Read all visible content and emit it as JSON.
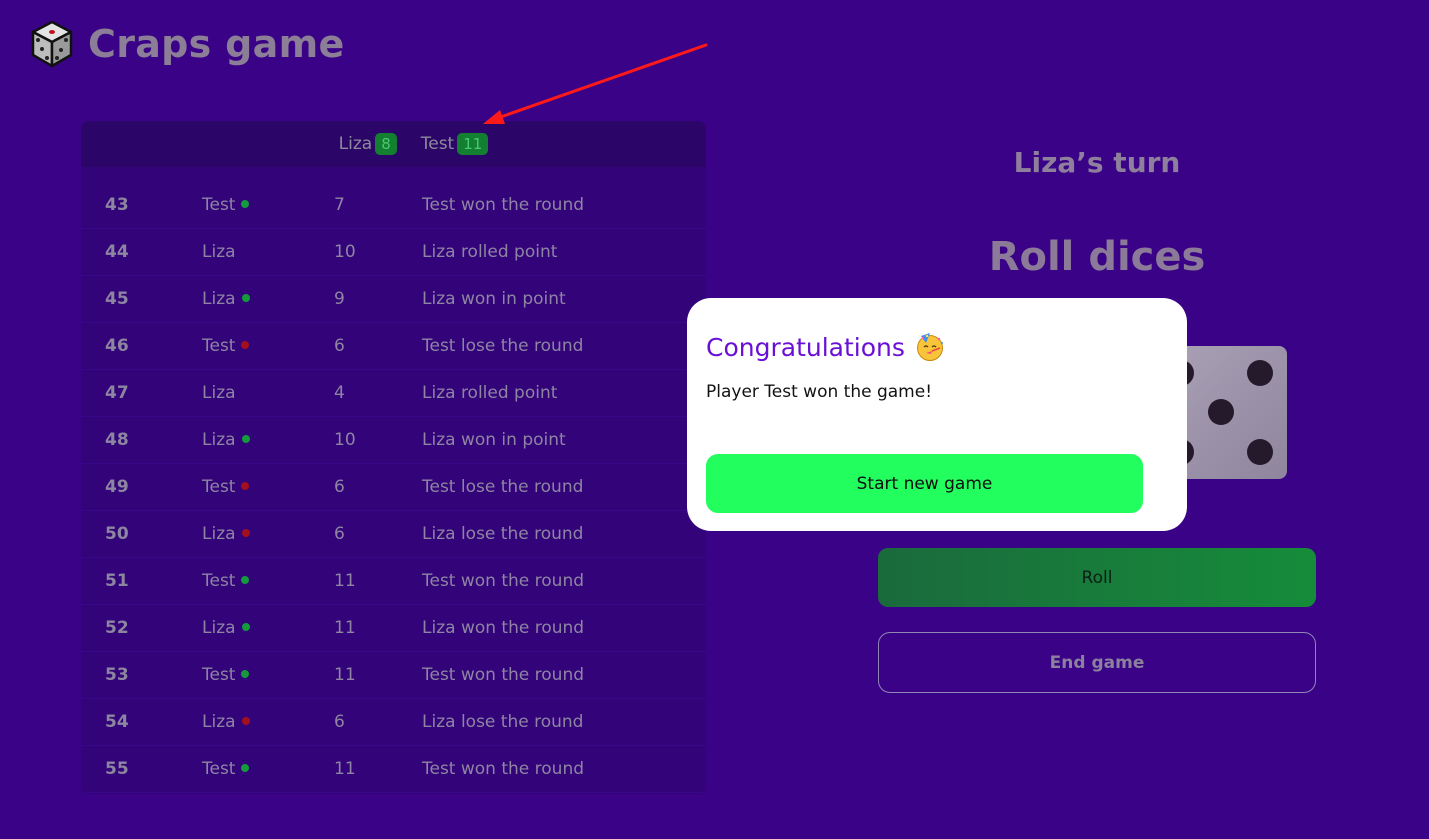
{
  "app": {
    "title": "Craps game",
    "logo_icon": "dice-icon"
  },
  "scoreboard": {
    "players": [
      {
        "name": "Liza",
        "score": "8"
      },
      {
        "name": "Test",
        "score": "11"
      }
    ]
  },
  "history": [
    {
      "num": "43",
      "player": "Test",
      "status": "win",
      "roll": "7",
      "result": "Test won the round"
    },
    {
      "num": "44",
      "player": "Liza",
      "status": "none",
      "roll": "10",
      "result": "Liza rolled point"
    },
    {
      "num": "45",
      "player": "Liza",
      "status": "win",
      "roll": "9",
      "result": "Liza won in point"
    },
    {
      "num": "46",
      "player": "Test",
      "status": "lose",
      "roll": "6",
      "result": "Test lose the round"
    },
    {
      "num": "47",
      "player": "Liza",
      "status": "none",
      "roll": "4",
      "result": "Liza rolled point"
    },
    {
      "num": "48",
      "player": "Liza",
      "status": "win",
      "roll": "10",
      "result": "Liza won in point"
    },
    {
      "num": "49",
      "player": "Test",
      "status": "lose",
      "roll": "6",
      "result": "Test lose the round"
    },
    {
      "num": "50",
      "player": "Liza",
      "status": "lose",
      "roll": "6",
      "result": "Liza lose the round"
    },
    {
      "num": "51",
      "player": "Test",
      "status": "win",
      "roll": "11",
      "result": "Test won the round"
    },
    {
      "num": "52",
      "player": "Liza",
      "status": "win",
      "roll": "11",
      "result": "Liza won the round"
    },
    {
      "num": "53",
      "player": "Test",
      "status": "win",
      "roll": "11",
      "result": "Test won the round"
    },
    {
      "num": "54",
      "player": "Liza",
      "status": "lose",
      "roll": "6",
      "result": "Liza lose the round"
    },
    {
      "num": "55",
      "player": "Test",
      "status": "win",
      "roll": "11",
      "result": "Test won the round"
    }
  ],
  "game": {
    "turn_label": "Liza’s turn",
    "roll_heading": "Roll dices",
    "roll_button": "Roll",
    "end_button": "End game"
  },
  "modal": {
    "title": "Congratulations",
    "title_icon": "party-face-icon",
    "message": "Player Test won the game!",
    "button": "Start new game"
  },
  "colors": {
    "background": "#3a0286",
    "win_dot": "#139b3c",
    "lose_dot": "#a40f1e",
    "score_badge": "#137f30",
    "new_game_button": "#21fe5d",
    "modal_title": "#6a10d6",
    "annotation_arrow": "#ff1a1a"
  }
}
